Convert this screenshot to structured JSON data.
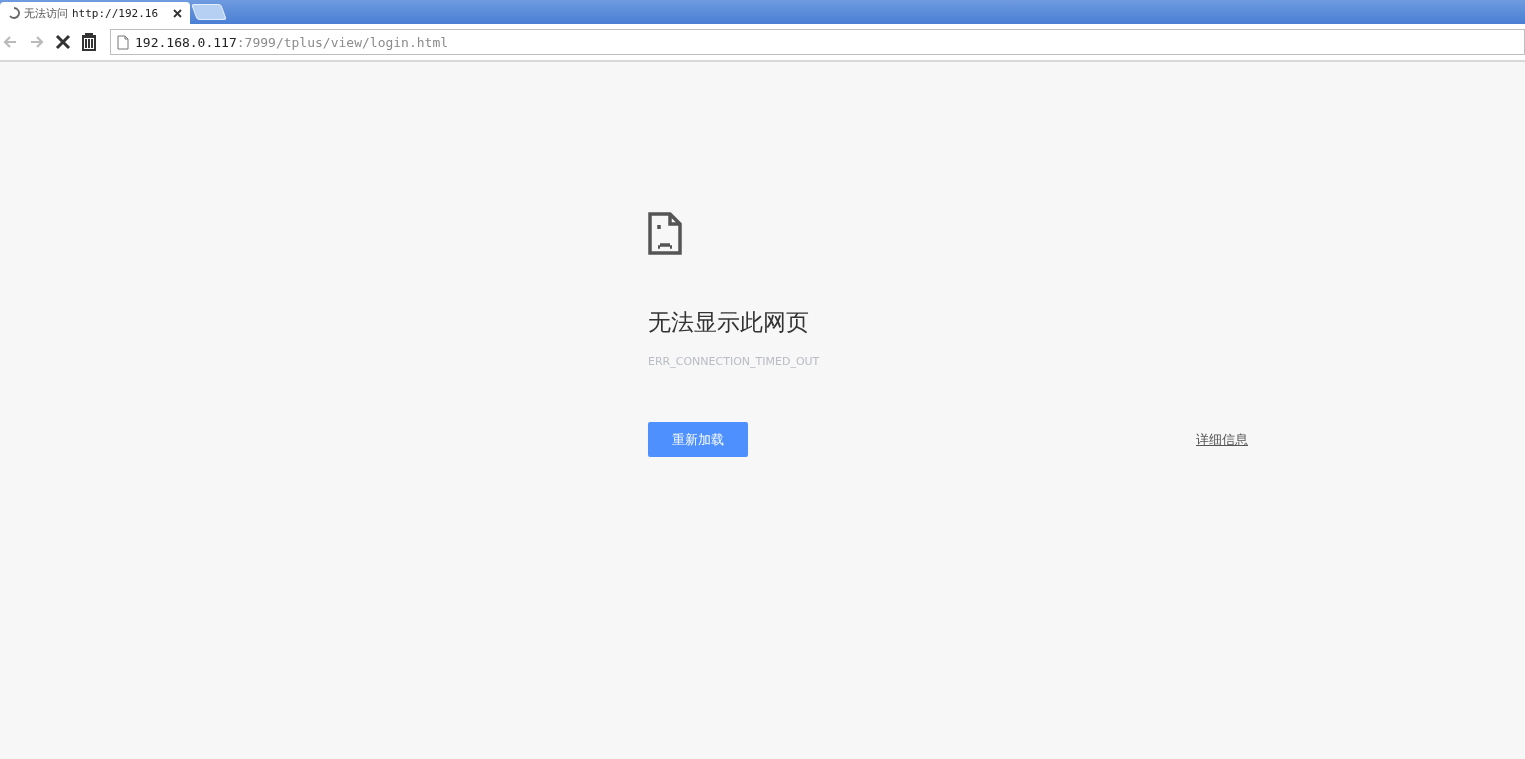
{
  "tabs": [
    {
      "title": "无法访问",
      "url": "http://192.16",
      "selected": true,
      "loading": true
    }
  ],
  "address_bar": {
    "host": "192.168.0.117",
    "path": ":7999/tplus/view/login.html"
  },
  "toolbar": {
    "back_disabled": true,
    "forward_disabled": true
  },
  "error": {
    "heading": "无法显示此网页",
    "code": "ERR_CONNECTION_TIMED_OUT",
    "reload_button": "重新加载",
    "details_link": "详细信息"
  }
}
